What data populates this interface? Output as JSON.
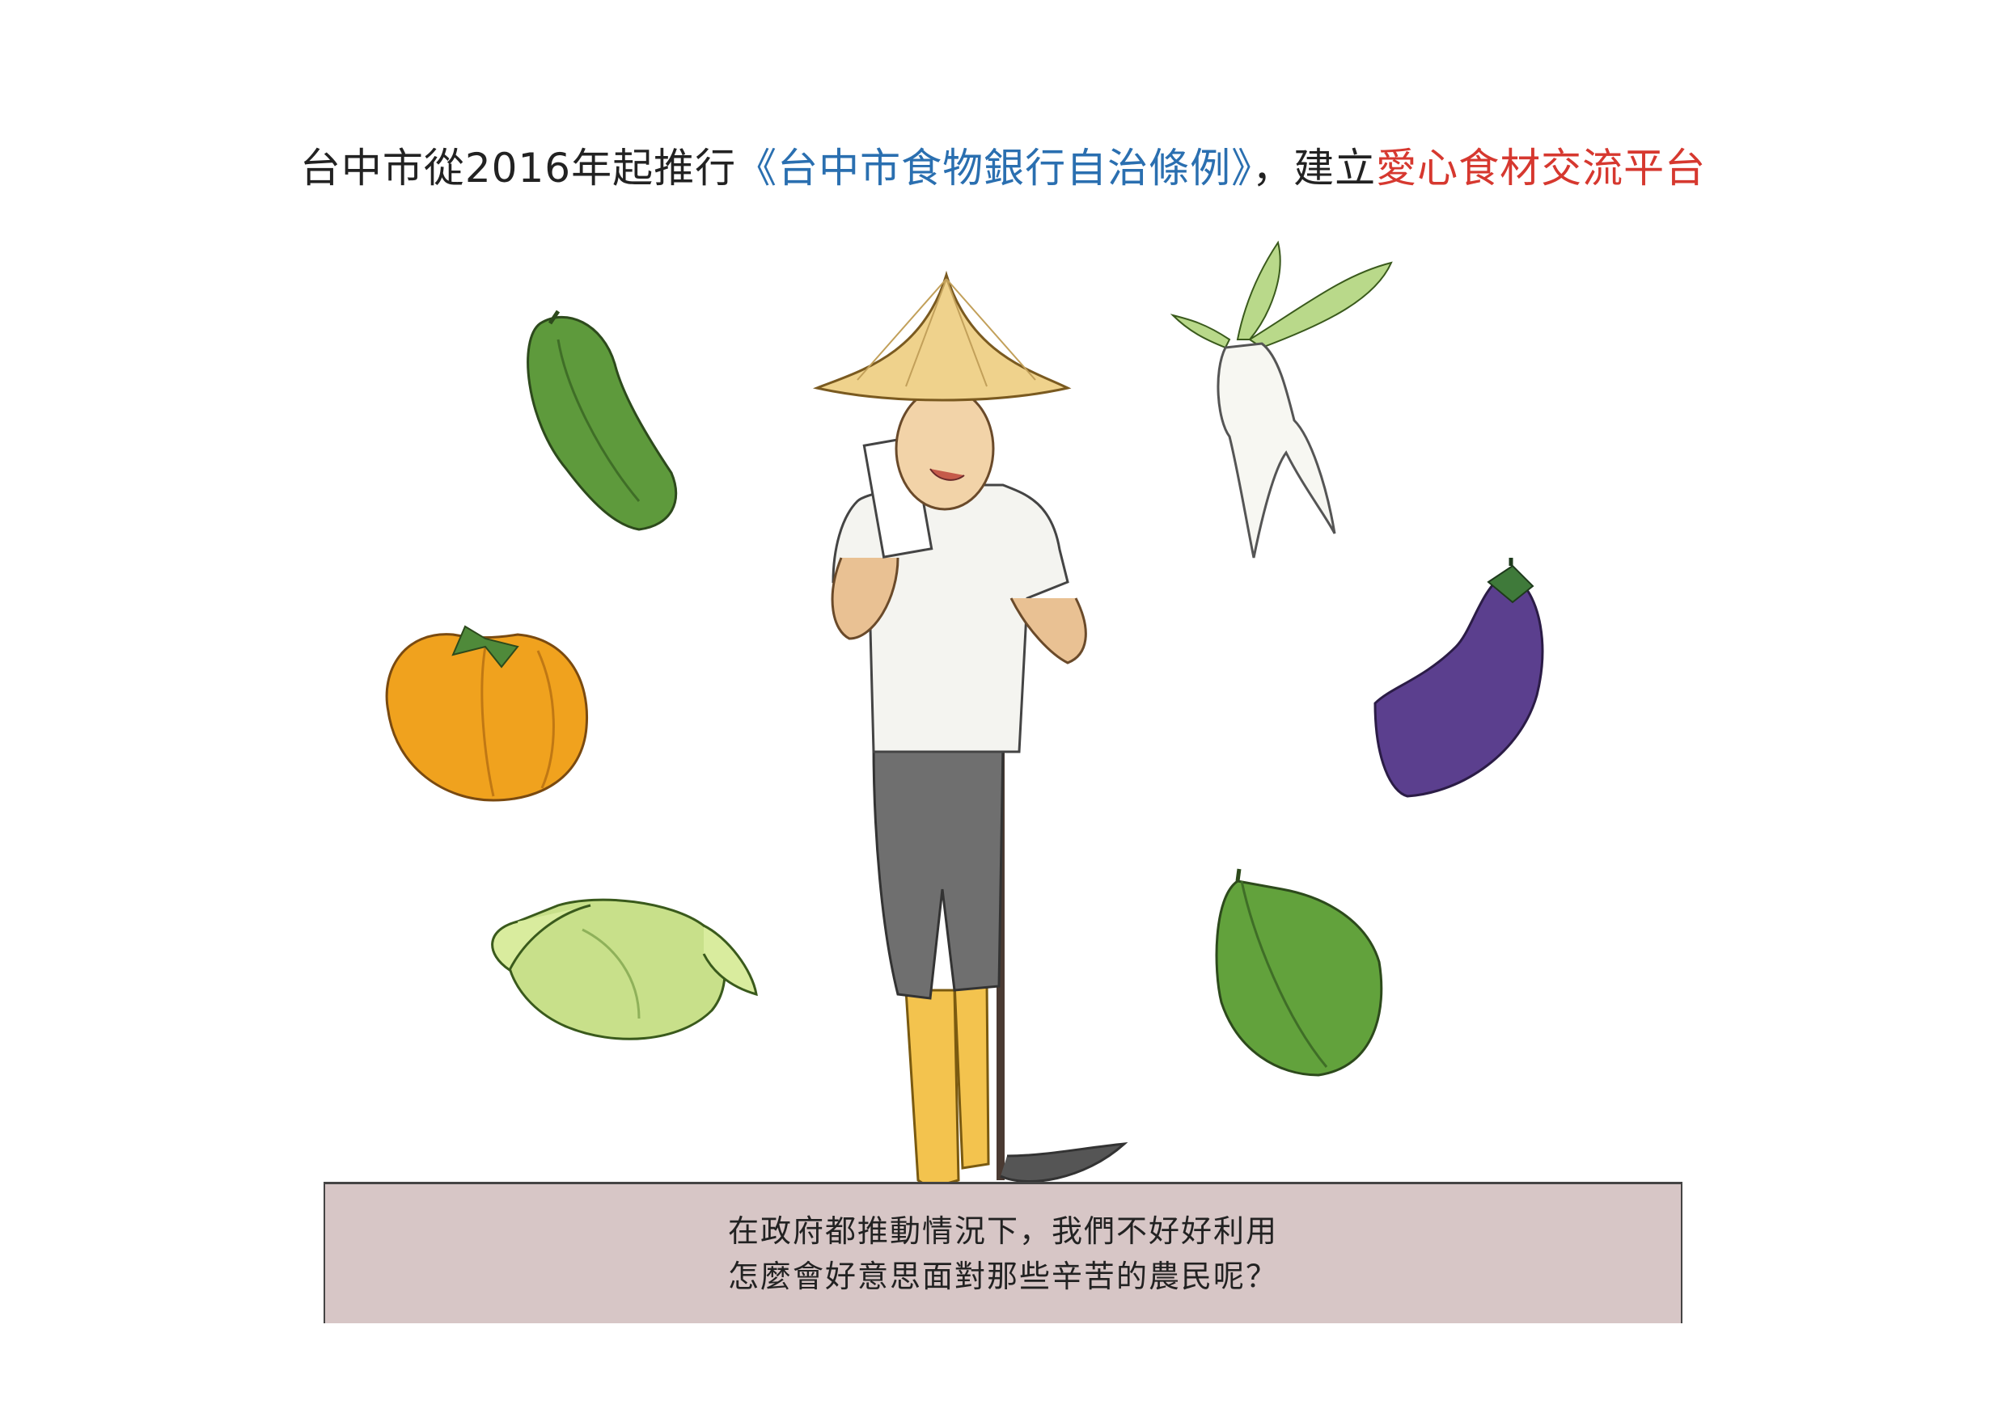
{
  "title": {
    "part1": "台中市從2016年起推行",
    "part2": "《台中市食物銀行自治條例》",
    "part3": "，建立",
    "part4": "愛心食材交流平台"
  },
  "caption": {
    "line1": "在政府都推動情況下，我們不好好利用",
    "line2": "怎麼會好意思面對那些辛苦的農民呢？"
  },
  "colors": {
    "blue": "#2a6fb0",
    "red": "#d6382f",
    "caption_bg": "#d7c6c6"
  }
}
